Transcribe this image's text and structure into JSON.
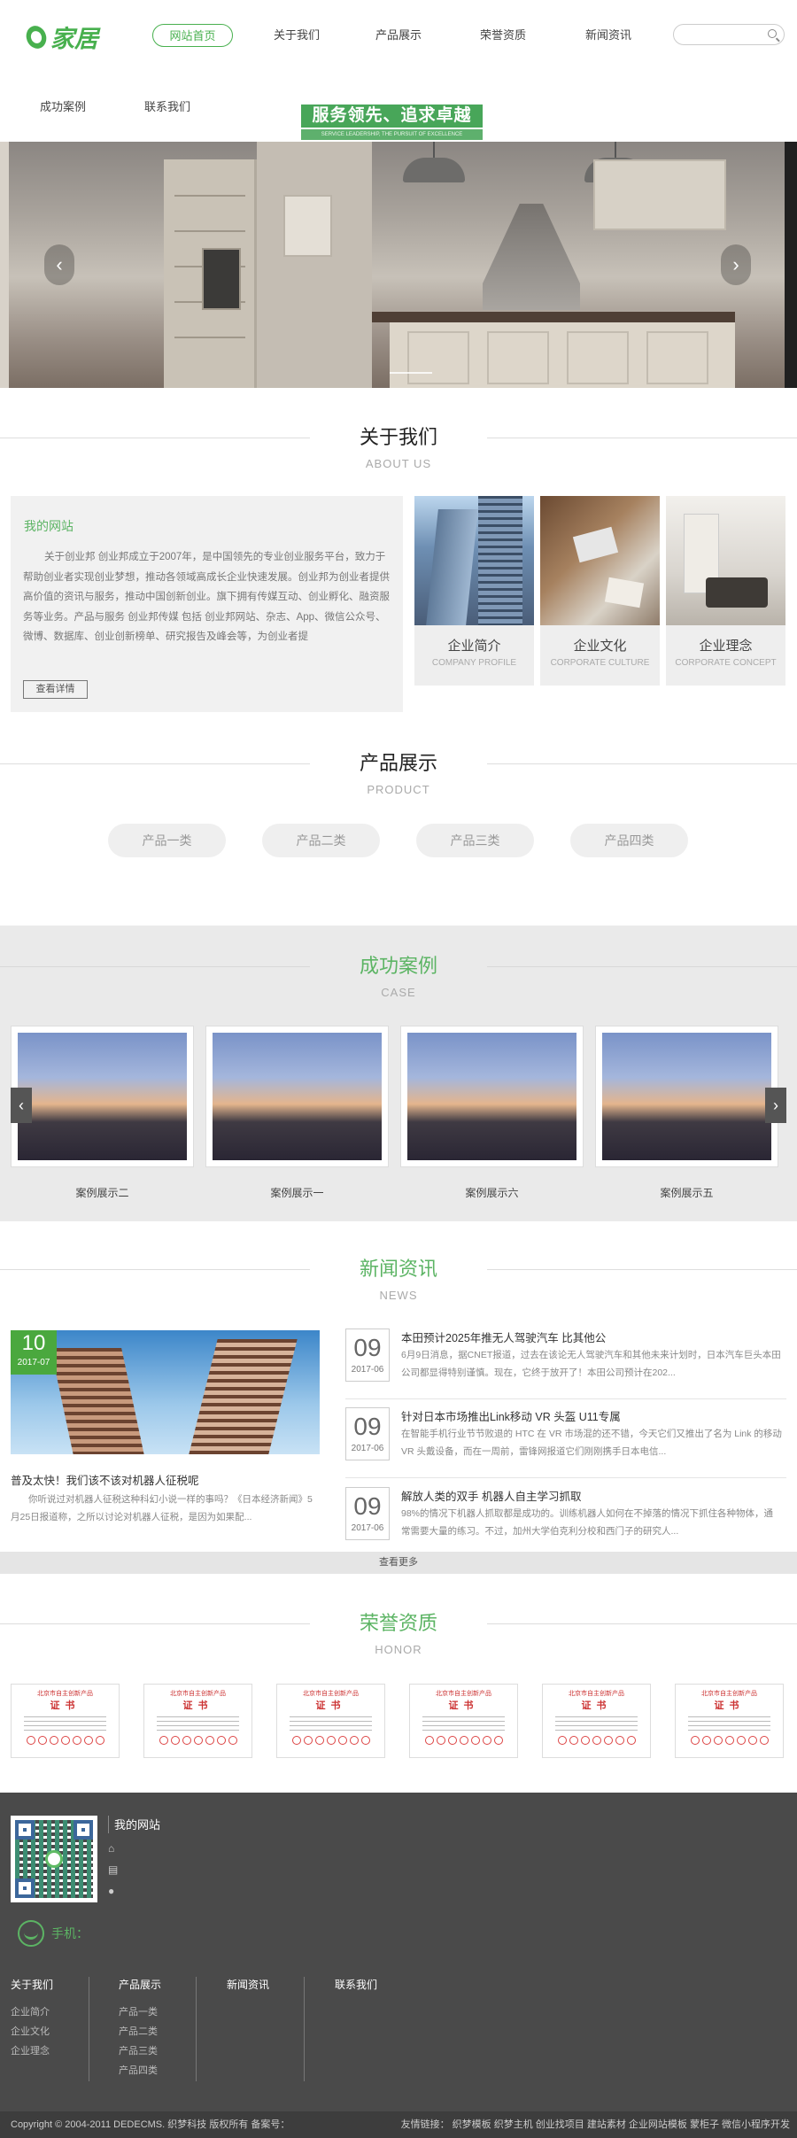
{
  "header": {
    "logo_text": "家居",
    "nav": [
      "网站首页",
      "关于我们",
      "产品展示",
      "荣誉资质",
      "新闻资讯"
    ],
    "nav_row2": [
      "成功案例",
      "联系我们"
    ],
    "search_placeholder": ""
  },
  "banner": {
    "slogan": "服务领先、追求卓越",
    "slogan_sub": "SERVICE LEADERSHIP, THE PURSUIT OF EXCELLENCE",
    "prev": "‹",
    "next": "›"
  },
  "about": {
    "title": "关于我们",
    "subtitle": "ABOUT US",
    "box_title": "我的网站",
    "text": "关于创业邦 创业邦成立于2007年，是中国领先的专业创业服务平台，致力于帮助创业者实现创业梦想，推动各领域高成长企业快速发展。创业邦为创业者提供高价值的资讯与服务，推动中国创新创业。旗下拥有传媒互动、创业孵化、融资服务等业务。产品与服务 创业邦传媒 包括 创业邦网站、杂志、App、微信公众号、微博、数据库、创业创新榜单、研究报告及峰会等，为创业者提",
    "more": "查看详情",
    "cards": [
      {
        "zh": "企业简介",
        "en": "COMPANY PROFILE"
      },
      {
        "zh": "企业文化",
        "en": "CORPORATE CULTURE"
      },
      {
        "zh": "企业理念",
        "en": "CORPORATE CONCEPT"
      }
    ]
  },
  "products": {
    "title": "产品展示",
    "subtitle": "PRODUCT",
    "tabs": [
      "产品一类",
      "产品二类",
      "产品三类",
      "产品四类"
    ]
  },
  "cases": {
    "title": "成功案例",
    "subtitle": "CASE",
    "items": [
      "案例展示二",
      "案例展示一",
      "案例展示六",
      "案例展示五"
    ],
    "prev": "‹",
    "next": "›"
  },
  "news": {
    "title": "新闻资讯",
    "subtitle": "NEWS",
    "lead": {
      "day": "10",
      "month": "2017-07",
      "title": "普及太快！我们该不该对机器人征税呢",
      "text": "你听说过对机器人征税这种科幻小说一样的事吗？《日本经济新闻》5月25日报道称，之所以讨论对机器人征税，是因为如果配..."
    },
    "items": [
      {
        "day": "09",
        "month": "2017-06",
        "title": "本田预计2025年推无人驾驶汽车 比其他公",
        "text": "6月9日消息，据CNET报道，过去在该论无人驾驶汽车和其他未来计划时，日本汽车巨头本田公司都显得特别谨慎。现在，它终于放开了！本田公司预计在202..."
      },
      {
        "day": "09",
        "month": "2017-06",
        "title": "针对日本市场推出Link移动 VR 头盔 U11专属",
        "text": "在智能手机行业节节败退的 HTC 在 VR 市场混的还不错，今天它们又推出了名为 Link 的移动 VR 头戴设备，而在一周前，雷锋网报道它们刚刚携手日本电信..."
      },
      {
        "day": "09",
        "month": "2017-06",
        "title": "解放人类的双手 机器人自主学习抓取",
        "text": "98%的情况下机器人抓取都是成功的。训练机器人如何在不掉落的情况下抓住各种物体，通常需要大量的练习。不过，加州大学伯克利分校和西门子的研究人..."
      }
    ],
    "more": "查看更多"
  },
  "honor": {
    "title": "荣誉资质",
    "subtitle": "HONOR",
    "cert_title": "北京市自主创新产品",
    "cert_word": "证书",
    "count": 6
  },
  "footer": {
    "site_name": "我的网站",
    "phone_label": "手机：",
    "columns": [
      {
        "title": "关于我们",
        "items": [
          "企业简介",
          "企业文化",
          "企业理念"
        ]
      },
      {
        "title": "产品展示",
        "items": [
          "产品一类",
          "产品二类",
          "产品三类",
          "产品四类"
        ]
      },
      {
        "title": "新闻资讯",
        "items": []
      },
      {
        "title": "联系我们",
        "items": []
      }
    ],
    "copyright": "Copyright © 2004-2011 DEDECMS. 织梦科技 版权所有 备案号：",
    "links": "友情链接： 织梦模板 织梦主机 创业找项目 建站素材 企业网站模板 蒙柜子 微信小程序开发"
  },
  "colors": {
    "accent": "#48b04e",
    "footer": "#4a4a4a"
  }
}
